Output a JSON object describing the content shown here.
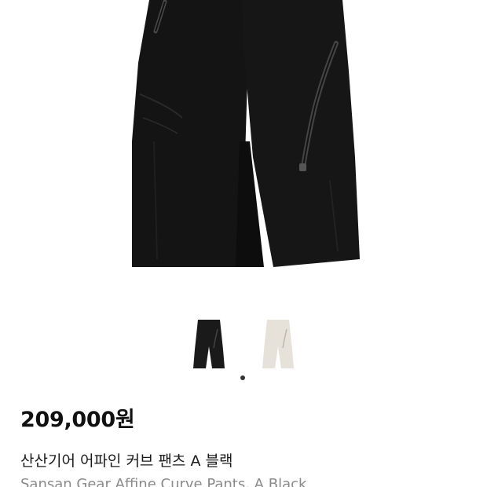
{
  "product": {
    "price": "209,000원",
    "name_ko": "산산기어 어파인 커브 팬츠 A 블랙",
    "name_en": "Sansan Gear Affine Curve Pants, A Black"
  },
  "gallery": {
    "thumbnails": [
      {
        "label": "black",
        "color": "#1a1a1a"
      },
      {
        "label": "ivory",
        "color": "#e6e2da"
      }
    ],
    "active_index": 0,
    "indicator_color": "#333333"
  },
  "colors": {
    "background": "#ffffff",
    "pants_main": "#141414",
    "pants_shadow": "#0a0a0a",
    "zipper": "#3a3a3a",
    "price_text": "#111111",
    "subtitle_text": "#8a8a8a"
  }
}
